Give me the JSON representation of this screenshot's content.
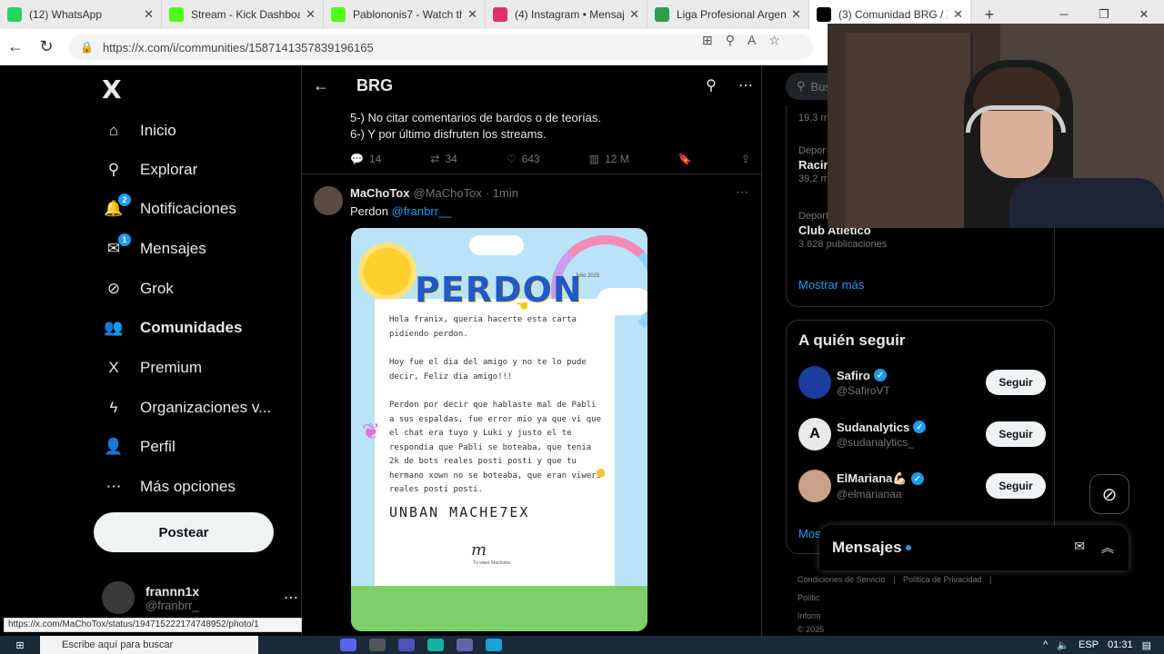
{
  "browser": {
    "tabs": [
      {
        "label": "(12) WhatsApp",
        "color": "#25d366",
        "icon": "whatsapp-icon"
      },
      {
        "label": "Stream - Kick Dashboard",
        "color": "#53fc18",
        "icon": "kick-icon"
      },
      {
        "label": "Pablononis7 - Watch th",
        "color": "#53fc18",
        "icon": "kick-icon"
      },
      {
        "label": "(4) Instagram • Mensaje",
        "color": "#e1306c",
        "icon": "instagram-icon"
      },
      {
        "label": "Liga Profesional Argenti",
        "color": "#2e9e4e",
        "icon": "globe-icon"
      },
      {
        "label": "(3) Comunidad BRG / X",
        "color": "#000000",
        "icon": "x-icon"
      }
    ],
    "url": "https://x.com/i/communities/1587141357839196165",
    "status_url": "https://x.com/MaChoTox/status/1947152221747489​52/photo/1"
  },
  "nav": {
    "logo": "X",
    "items": [
      {
        "label": "Inicio",
        "icon": "home-icon",
        "glyph": "⌂",
        "badge": ""
      },
      {
        "label": "Explorar",
        "icon": "search-icon",
        "glyph": "⚲",
        "badge": ""
      },
      {
        "label": "Notificaciones",
        "icon": "bell-icon",
        "glyph": "🔔",
        "badge": "2"
      },
      {
        "label": "Mensajes",
        "icon": "mail-icon",
        "glyph": "✉",
        "badge": "1"
      },
      {
        "label": "Grok",
        "icon": "grok-icon",
        "glyph": "⊘",
        "badge": ""
      },
      {
        "label": "Comunidades",
        "icon": "communities-icon",
        "glyph": "👥",
        "badge": ""
      },
      {
        "label": "Premium",
        "icon": "x-premium-icon",
        "glyph": "X",
        "badge": ""
      },
      {
        "label": "Organizaciones v...",
        "icon": "lightning-icon",
        "glyph": "ϟ",
        "badge": ""
      },
      {
        "label": "Perfil",
        "icon": "person-icon",
        "glyph": "👤",
        "badge": ""
      },
      {
        "label": "Más opciones",
        "icon": "more-circle-icon",
        "glyph": "⋯",
        "badge": ""
      }
    ],
    "post_button": "Postear",
    "account": {
      "name": "frannn1x",
      "handle": "@franbrr_"
    }
  },
  "center": {
    "title": "BRG",
    "prev_post": {
      "lines": [
        "5-) No citar comentarios de bardos o de teorías.",
        "6-) Y por último disfruten los streams."
      ],
      "replies": "14",
      "reposts": "34",
      "likes": "643",
      "views": "12 M"
    },
    "post": {
      "name": "MaChoTox",
      "handle": "@MaChoTox",
      "time": "· 1min",
      "text": "Perdon ",
      "mention": "@franbrr__",
      "image": {
        "title": "PERDON",
        "date": "Julio 2025",
        "p1": "Hola franix, queria hacerte esta carta pidiendo perdon.",
        "p2": "Hoy fue el dia del amigo y no te lo pude decir, Feliz dia amigo!!!",
        "p3": "Perdon por decir que hablaste mal de Pabli a sus espaldas, fue error mio ya que vi que el chat era tuyo y Luki y justo el te respondia que Pabli se boteaba, que tenia 2k de bots reales posti posti y que tu hermano xown no se boteaba, que eran viwers reales posti posti.",
        "unban": "UNBAN MACHE7EX",
        "signature": "m",
        "signature_caption": "Tu viwer Machotox"
      }
    }
  },
  "right": {
    "search_placeholder": "Bus",
    "trends": [
      {
        "category": "",
        "name": "",
        "count": "19,3 m"
      },
      {
        "category": "Depor",
        "name": "Racin",
        "count": "39,2 m"
      },
      {
        "category": "Deport",
        "name": "Club Atlético",
        "count": "3.628 publicaciones"
      }
    ],
    "show_more": "Mostrar más",
    "follow_title": "A quién seguir",
    "follows": [
      {
        "name": "Safiro",
        "handle": "@SafiroVT",
        "avatar_color": "#1c3f9e",
        "initial": ""
      },
      {
        "name": "Sudanalytics",
        "handle": "@sudanalytics_",
        "avatar_color": "#e7e9ea",
        "initial": "A"
      },
      {
        "name": "ElMariana💪🏻",
        "handle": "@elmarianaa",
        "avatar_color": "#c9a08a",
        "initial": ""
      }
    ],
    "follow_button": "Seguir",
    "show_more_2": "Mostrar más",
    "footer": [
      "Condiciones de Servicio",
      "|",
      "Política de Privacidad",
      "|",
      "Polític",
      "Inform",
      "© 2025"
    ],
    "messages_title": "Mensajes"
  },
  "taskbar": {
    "search": "Escribe aquí para buscar",
    "lang": "ESP",
    "time": "01:31"
  }
}
